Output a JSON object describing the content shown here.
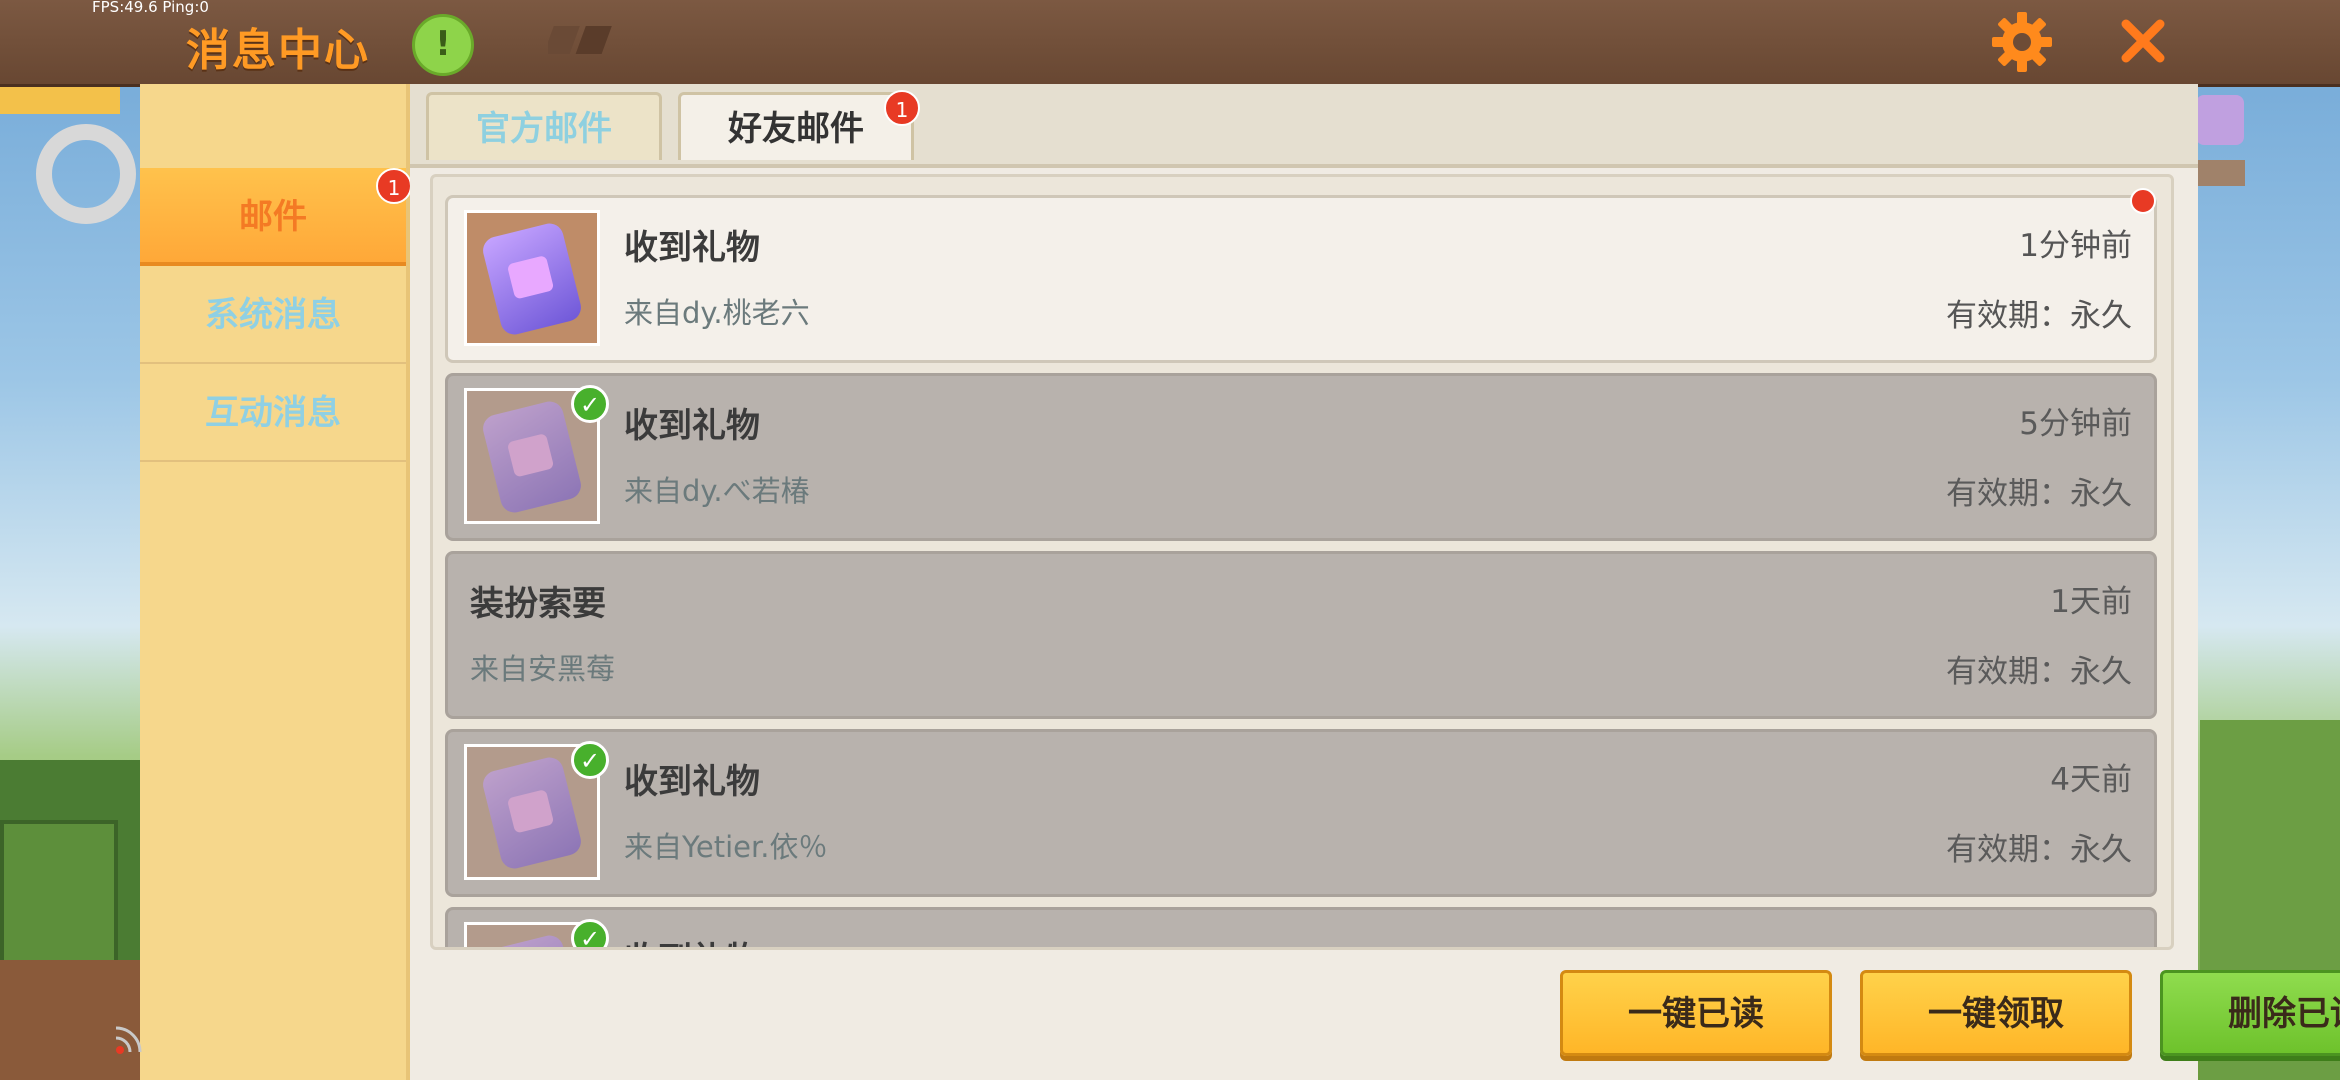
{
  "status": {
    "fps_text": "FPS:49.6  Ping:0"
  },
  "header": {
    "title": "消息中心",
    "notice_icon": "exclamation-icon",
    "notice_symbol": "!",
    "settings_icon": "gear-icon",
    "close_icon": "close-icon"
  },
  "sidebar": {
    "items": [
      {
        "label": "邮件",
        "active": true,
        "badge": "1"
      },
      {
        "label": "系统消息",
        "active": false
      },
      {
        "label": "互动消息",
        "active": false
      }
    ]
  },
  "tabs": [
    {
      "label": "官方邮件",
      "active": false
    },
    {
      "label": "好友邮件",
      "active": true,
      "badge": "1"
    }
  ],
  "mails": [
    {
      "title": "收到礼物",
      "from": "来自dy.桃老六",
      "time": "1分钟前",
      "validity": "有效期：永久",
      "read": false,
      "has_gift": true,
      "claimed": false
    },
    {
      "title": "收到礼物",
      "from": "来自dy.べ若椿",
      "time": "5分钟前",
      "validity": "有效期：永久",
      "read": true,
      "has_gift": true,
      "claimed": true
    },
    {
      "title": "装扮索要",
      "from": "来自安黑莓",
      "time": "1天前",
      "validity": "有效期：永久",
      "read": true,
      "has_gift": false,
      "claimed": false
    },
    {
      "title": "收到礼物",
      "from": "来自Yetier.依％",
      "time": "4天前",
      "validity": "有效期：永久",
      "read": true,
      "has_gift": true,
      "claimed": true
    },
    {
      "title": "收到礼物",
      "from": "",
      "time": "",
      "validity": "",
      "read": true,
      "has_gift": true,
      "claimed": true
    }
  ],
  "actions": {
    "mark_all_read": "一键已读",
    "claim_all": "一键领取",
    "delete_read": "删除已读"
  },
  "colors": {
    "title_orange": "#ff9a24",
    "badge_red": "#e83a24",
    "button_yellow": "#ffc23a",
    "button_green": "#7ccc3a"
  }
}
